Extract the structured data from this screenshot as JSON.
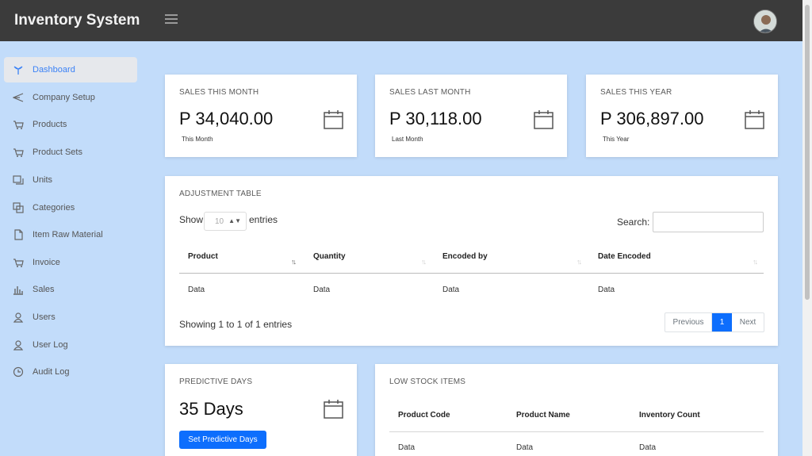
{
  "app": {
    "title": "Inventory System"
  },
  "sidebar": {
    "items": [
      {
        "label": "Dashboard",
        "icon": "dashboard-icon",
        "active": true
      },
      {
        "label": "Company Setup",
        "icon": "send-icon"
      },
      {
        "label": "Products",
        "icon": "cart-icon"
      },
      {
        "label": "Product Sets",
        "icon": "cart-icon"
      },
      {
        "label": "Units",
        "icon": "copy-icon"
      },
      {
        "label": "Categories",
        "icon": "layers-icon"
      },
      {
        "label": "Item Raw Material",
        "icon": "file-icon"
      },
      {
        "label": "Invoice",
        "icon": "cart-icon"
      },
      {
        "label": "Sales",
        "icon": "bar-chart-icon"
      },
      {
        "label": "Users",
        "icon": "user-icon"
      },
      {
        "label": "User Log",
        "icon": "user-icon"
      },
      {
        "label": "Audit Log",
        "icon": "clock-icon"
      }
    ]
  },
  "stats": {
    "this_month": {
      "title": "SALES THIS MONTH",
      "value": "P 34,040.00",
      "sub": "This Month"
    },
    "last_month": {
      "title": "SALES LAST MONTH",
      "value": "P 30,118.00",
      "sub": "Last Month"
    },
    "this_year": {
      "title": "SALES THIS YEAR",
      "value": "P 306,897.00",
      "sub": "This Year"
    }
  },
  "adjustment": {
    "title": "ADJUSTMENT TABLE",
    "show_label": "Show",
    "entries_value": "10",
    "entries_label": "entries",
    "search_label": "Search:",
    "search_value": "",
    "columns": [
      "Product",
      "Quantity",
      "Encoded by",
      "Date Encoded"
    ],
    "rows": [
      [
        "Data",
        "Data",
        "Data",
        "Data"
      ]
    ],
    "info": "Showing 1 to 1 of 1 entries",
    "pagination": {
      "prev": "Previous",
      "page": "1",
      "next": "Next"
    }
  },
  "predictive": {
    "title": "PREDICTIVE DAYS",
    "value": "35 Days",
    "button": "Set Predictive Days"
  },
  "low_stock": {
    "title": "LOW STOCK ITEMS",
    "columns": [
      "Product Code",
      "Product Name",
      "Inventory Count"
    ],
    "rows": [
      [
        "Data",
        "Data",
        "Data"
      ]
    ]
  },
  "colors": {
    "accent": "#0d6efd",
    "topbar": "#3b3b3b",
    "background": "#c2dcfa"
  }
}
